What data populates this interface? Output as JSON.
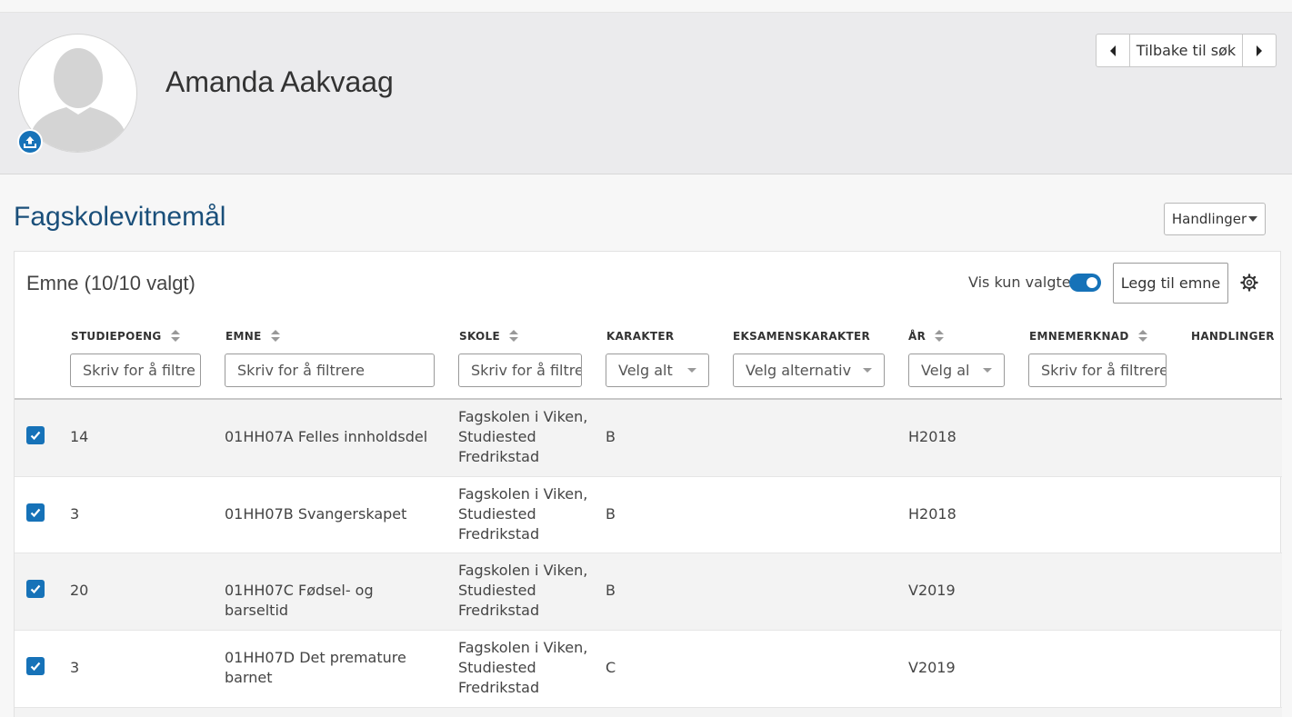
{
  "profile": {
    "name": "Amanda Aakvaag",
    "back_to_search": "Tilbake til søk"
  },
  "section": {
    "title": "Fagskolevitnemål",
    "actions_label": "Handlinger"
  },
  "card": {
    "title": "Emne (10/10 valgt)",
    "show_only_selected_label": "Vis kun valgte",
    "show_only_selected": true,
    "add_button": "Legg til emne"
  },
  "columns": {
    "studiepoeng": "STUDIEPOENG",
    "emne": "EMNE",
    "skole": "SKOLE",
    "karakter": "KARAKTER",
    "eksamenskarakter": "EKSAMENSKARAKTER",
    "ar": "ÅR",
    "emnemerknad": "EMNEMERKNAD",
    "handlinger": "HANDLINGER"
  },
  "filters": {
    "studiepoeng": "Skriv for å filtre",
    "emne": "Skriv for å filtrere",
    "skole": "Skriv for å filtre",
    "karakter": "Velg alt",
    "eksamenskarakter": "Velg alternativ",
    "ar": "Velg al",
    "emnemerknad": "Skriv for å filtrere"
  },
  "rows": [
    {
      "checked": true,
      "studiepoeng": "14",
      "emne": "01HH07A Felles innholdsdel",
      "skole": "Fagskolen i Viken, Studiested Fredrikstad",
      "karakter": "B",
      "eksamenskarakter": "",
      "ar": "H2018",
      "emnemerknad": ""
    },
    {
      "checked": true,
      "studiepoeng": "3",
      "emne": "01HH07B Svangerskapet",
      "skole": "Fagskolen i Viken, Studiested Fredrikstad",
      "karakter": "B",
      "eksamenskarakter": "",
      "ar": "H2018",
      "emnemerknad": ""
    },
    {
      "checked": true,
      "studiepoeng": "20",
      "emne": "01HH07C Fødsel- og barseltid",
      "skole": "Fagskolen i Viken, Studiested Fredrikstad",
      "karakter": "B",
      "eksamenskarakter": "",
      "ar": "V2019",
      "emnemerknad": ""
    },
    {
      "checked": true,
      "studiepoeng": "3",
      "emne": "01HH07D Det premature barnet",
      "skole": "Fagskolen i Viken, Studiested Fredrikstad",
      "karakter": "C",
      "eksamenskarakter": "",
      "ar": "V2019",
      "emnemerknad": ""
    }
  ],
  "colors": {
    "primary": "#1672b8",
    "title": "#1a4f7a",
    "profile_bg": "#ebebed"
  }
}
